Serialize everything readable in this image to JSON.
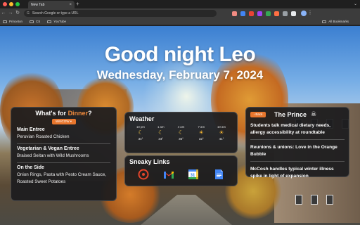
{
  "browser": {
    "tab_title": "New Tab",
    "omnibox_placeholder": "Search Google or type a URL",
    "bookmarks": [
      "Princeton",
      "CS",
      "YouTube"
    ],
    "all_bookmarks": "All Bookmarks",
    "traffic_colors": [
      "#ff5f57",
      "#febc2e",
      "#28c840"
    ],
    "extension_colors": [
      "#f28b82",
      "#4285f4",
      "#ea4335",
      "#a142f4",
      "#34a853",
      "#ff7043",
      "#9aa0a6"
    ]
  },
  "greeting": "Good night Leo",
  "date": "Wednesday, February 7, 2024",
  "dining": {
    "title_prefix": "What's for ",
    "title_accent": "Dinner",
    "title_suffix": "?",
    "button": "WiNCOW ▾",
    "sections": [
      {
        "heading": "Main Entree",
        "items": "Peruvian Roasted Chicken"
      },
      {
        "heading": "Vegetarian & Vegan Entree",
        "items": "Braised Seitan with Wild Mushrooms"
      },
      {
        "heading": "On the Side",
        "items": "Onion Rings, Pasta with Pesto Cream Sauce, Roasted Sweet Potatoes"
      }
    ]
  },
  "weather": {
    "title": "Weather",
    "hours": [
      {
        "time": "10 pm",
        "icon": "moon-icon",
        "temp": "34°"
      },
      {
        "time": "1 am",
        "icon": "moon-icon",
        "temp": "34°"
      },
      {
        "time": "4 am",
        "icon": "moon-icon",
        "temp": "35°"
      },
      {
        "time": "7 am",
        "icon": "sun-icon",
        "temp": "32°"
      },
      {
        "time": "10 am",
        "icon": "sun-icon",
        "temp": "41°"
      }
    ]
  },
  "links": {
    "title": "Sneaky Links",
    "items": [
      "canvas-icon",
      "gmail-icon",
      "calendar-icon",
      "docs-icon"
    ],
    "calendar_day": "31"
  },
  "prince": {
    "back": "‹ Back",
    "title": "The Prince",
    "news": [
      "Students talk medical dietary needs, allergy accessibility at roundtable",
      "Reunions & unions: Love in the Orange Bubble",
      "McCosh handles typical winter illness spike in light of expansion"
    ]
  },
  "accent_color": "#e8762d"
}
